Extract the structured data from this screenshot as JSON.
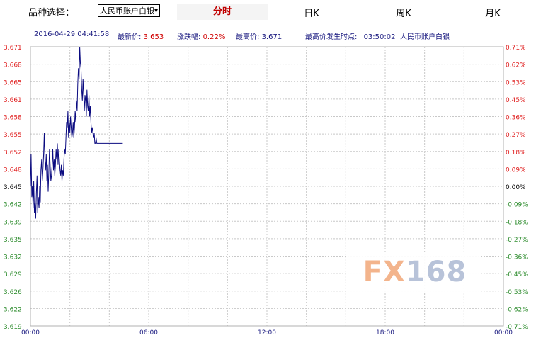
{
  "header": {
    "select_label": "品种选择：",
    "selected_instrument": "人民币账户白银",
    "tabs": [
      {
        "label": "分时",
        "active": true
      },
      {
        "label": "日K",
        "active": false
      },
      {
        "label": "周K",
        "active": false
      },
      {
        "label": "月K",
        "active": false
      }
    ]
  },
  "info": {
    "datetime": "2016-04-29 04:41:58",
    "latest_label": "最新价:",
    "latest_value": "3.653",
    "change_label": "涨跌幅:",
    "change_value": "0.22%",
    "high_label": "最高价:",
    "high_value": "3.671",
    "high_time_label": "最高价发生时点:",
    "high_time_value": "03:50:02",
    "instrument": "人民币账户白银"
  },
  "watermark": {
    "fx": "FX",
    "num": "168"
  },
  "colors": {
    "up": "#e02020",
    "down": "#2a8a2a",
    "neutral": "#000000",
    "line": "#0b0b80",
    "grid": "#c8c8c8"
  },
  "chart_data": {
    "type": "line",
    "base_price": 3.645,
    "x_ticks": [
      "00:00",
      "06:00",
      "12:00",
      "18:00",
      "00:00"
    ],
    "x_range_minutes": [
      0,
      1440
    ],
    "ylim": [
      3.619,
      3.671
    ],
    "y_ticks_left": [
      "3.671",
      "3.668",
      "3.665",
      "3.661",
      "3.658",
      "3.655",
      "3.652",
      "3.648",
      "3.645",
      "3.642",
      "3.639",
      "3.635",
      "3.632",
      "3.629",
      "3.626",
      "3.622",
      "3.619"
    ],
    "y_ticks_right": [
      "0.71%",
      "0.62%",
      "0.53%",
      "0.45%",
      "0.36%",
      "0.27%",
      "0.18%",
      "0.09%",
      "0.00%",
      "-0.09%",
      "-0.18%",
      "-0.27%",
      "-0.36%",
      "-0.45%",
      "-0.53%",
      "-0.62%",
      "-0.71%"
    ],
    "grid": true,
    "series": [
      {
        "x": [
          0,
          2,
          4,
          6,
          8,
          10,
          12,
          14,
          16,
          18,
          20,
          22,
          24,
          26,
          28,
          30,
          32,
          34,
          36,
          38,
          40,
          42,
          44,
          46,
          48,
          50,
          52,
          54,
          56,
          58,
          60,
          62,
          64,
          66,
          68,
          70,
          72,
          74,
          76,
          78,
          80,
          82,
          84,
          86,
          88,
          90,
          92,
          94,
          96,
          98,
          100,
          102,
          104,
          106,
          108,
          110,
          112,
          114,
          116,
          118,
          120,
          122,
          124,
          126,
          128,
          130,
          132,
          134,
          136,
          138,
          140,
          142,
          144,
          146,
          148,
          150,
          152,
          154,
          156,
          158,
          160,
          162,
          164,
          166,
          168,
          170,
          172,
          174,
          176,
          178,
          180,
          182,
          184,
          186,
          188,
          190,
          192,
          194,
          196,
          198,
          200,
          202,
          204,
          206,
          208,
          210,
          212,
          214,
          216,
          218,
          220,
          222,
          224,
          226,
          228,
          230,
          232,
          234,
          236,
          238,
          240,
          242,
          244,
          246,
          248,
          250,
          252,
          254,
          256,
          258,
          260,
          262,
          264,
          266,
          268,
          270,
          272,
          274,
          276,
          278,
          280,
          281
        ],
        "y": [
          3.645,
          3.651,
          3.643,
          3.645,
          3.641,
          3.646,
          3.64,
          3.642,
          3.639,
          3.644,
          3.647,
          3.64,
          3.643,
          3.641,
          3.645,
          3.642,
          3.648,
          3.65,
          3.646,
          3.648,
          3.651,
          3.655,
          3.65,
          3.648,
          3.651,
          3.646,
          3.649,
          3.644,
          3.648,
          3.652,
          3.649,
          3.646,
          3.647,
          3.649,
          3.652,
          3.648,
          3.65,
          3.647,
          3.649,
          3.652,
          3.65,
          3.653,
          3.649,
          3.652,
          3.65,
          3.648,
          3.647,
          3.649,
          3.646,
          3.648,
          3.647,
          3.65,
          3.652,
          3.651,
          3.654,
          3.657,
          3.656,
          3.659,
          3.654,
          3.657,
          3.655,
          3.658,
          3.656,
          3.654,
          3.655,
          3.657,
          3.654,
          3.656,
          3.659,
          3.657,
          3.661,
          3.659,
          3.664,
          3.667,
          3.665,
          3.671,
          3.668,
          3.667,
          3.663,
          3.661,
          3.665,
          3.662,
          3.659,
          3.662,
          3.661,
          3.658,
          3.663,
          3.66,
          3.659,
          3.662,
          3.658,
          3.66,
          3.657,
          3.655,
          3.656,
          3.655,
          3.654,
          3.655,
          3.653,
          3.653,
          3.654,
          3.653,
          3.653,
          3.653,
          3.653,
          3.653,
          3.653,
          3.653,
          3.653,
          3.653,
          3.653,
          3.653,
          3.653,
          3.653,
          3.653,
          3.653,
          3.653,
          3.653,
          3.653,
          3.653,
          3.653,
          3.653,
          3.653,
          3.653,
          3.653,
          3.653,
          3.653,
          3.653,
          3.653,
          3.653,
          3.653,
          3.653,
          3.653,
          3.653,
          3.653,
          3.653,
          3.653,
          3.653,
          3.653,
          3.653,
          3.653,
          3.653
        ]
      }
    ]
  }
}
